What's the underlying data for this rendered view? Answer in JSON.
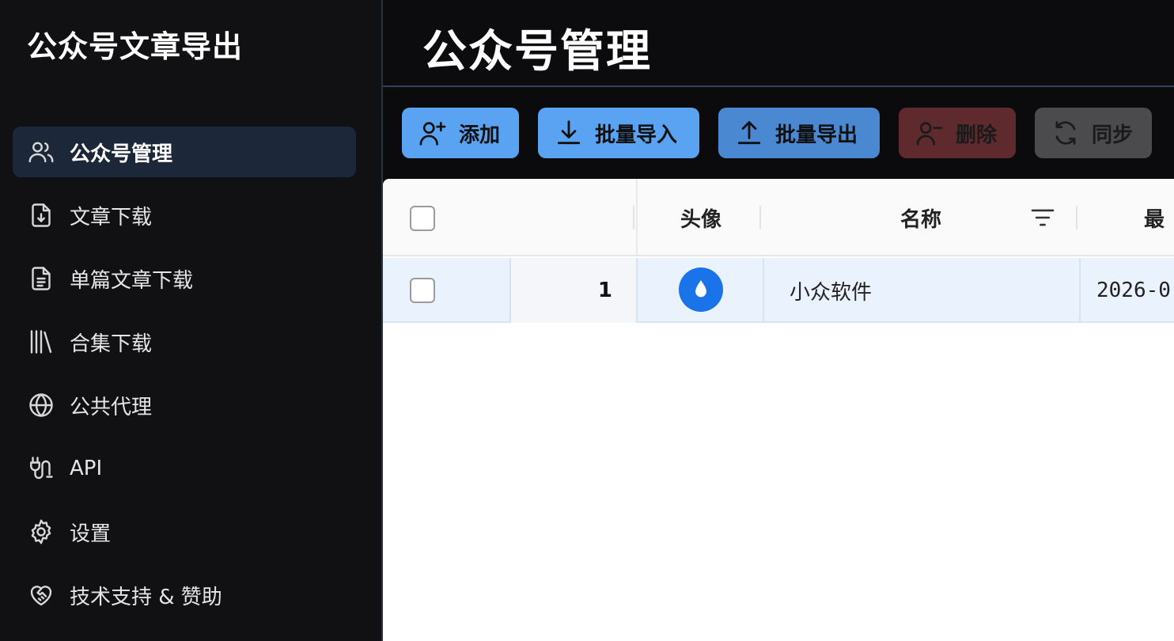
{
  "app": {
    "title": "公众号文章导出"
  },
  "sidebar": {
    "items": [
      {
        "label": "公众号管理",
        "icon": "users-icon",
        "active": true
      },
      {
        "label": "文章下载",
        "icon": "file-download-icon"
      },
      {
        "label": "单篇文章下载",
        "icon": "file-text-icon"
      },
      {
        "label": "合集下载",
        "icon": "library-icon"
      },
      {
        "label": "公共代理",
        "icon": "globe-icon"
      },
      {
        "label": "API",
        "icon": "plug-icon"
      },
      {
        "label": "设置",
        "icon": "gear-icon"
      },
      {
        "label": "技术支持 & 赞助",
        "icon": "heart-handshake-icon"
      }
    ]
  },
  "header": {
    "title": "公众号管理"
  },
  "toolbar": {
    "add_label": "添加",
    "import_label": "批量导入",
    "export_label": "批量导出",
    "delete_label": "删除",
    "sync_label": "同步"
  },
  "table": {
    "columns": {
      "avatar": "头像",
      "name": "名称",
      "latest": "最"
    },
    "rows": [
      {
        "index": "1",
        "name": "小众软件",
        "date": "2026-0"
      }
    ]
  },
  "colors": {
    "accent": "#5aa2f2",
    "sidebar_active": "#1c283a",
    "delete_bg": "#5e2a2e",
    "row_selected": "#eaf3fd"
  }
}
